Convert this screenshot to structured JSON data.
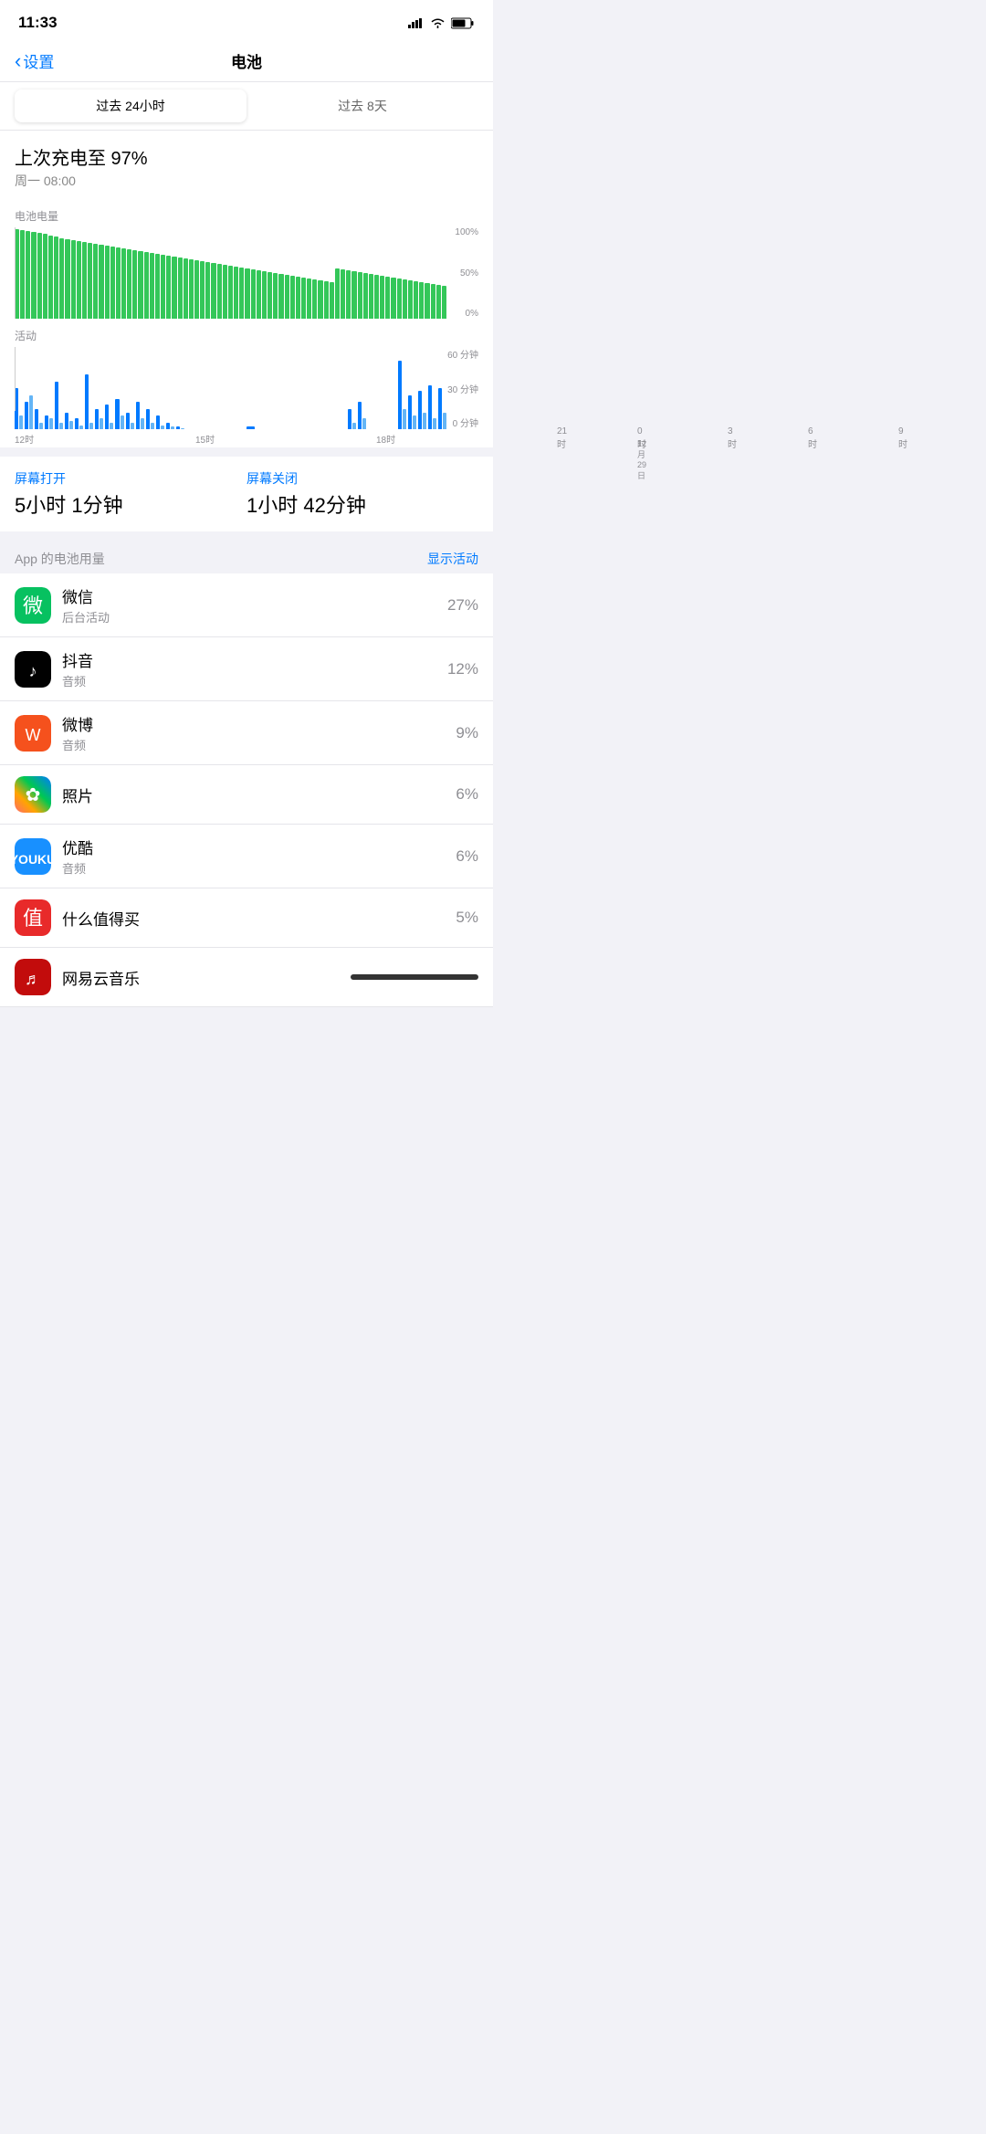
{
  "statusBar": {
    "time": "11:33"
  },
  "navBar": {
    "backLabel": "设置",
    "title": "电池"
  },
  "tabs": [
    {
      "label": "过去 24小时",
      "active": true
    },
    {
      "label": "过去 8天",
      "active": false
    }
  ],
  "lastCharge": {
    "title": "上次充电至 97%",
    "time": "周一 08:00"
  },
  "batteryChart": {
    "label": "电池电量",
    "yLabels": [
      "100%",
      "50%",
      "0%"
    ],
    "bars": [
      98,
      97,
      96,
      95,
      94,
      93,
      91,
      90,
      88,
      87,
      86,
      85,
      84,
      83,
      82,
      81,
      80,
      79,
      78,
      77,
      76,
      75,
      74,
      73,
      72,
      71,
      70,
      69,
      68,
      67,
      66,
      65,
      64,
      63,
      62,
      61,
      60,
      59,
      58,
      57,
      56,
      55,
      54,
      53,
      52,
      51,
      50,
      49,
      48,
      47,
      46,
      45,
      44,
      43,
      42,
      41,
      40,
      55,
      54,
      53,
      52,
      51,
      50,
      49,
      48,
      47,
      46,
      45,
      44,
      43,
      42,
      41,
      40,
      39,
      38,
      37,
      36
    ]
  },
  "activityChart": {
    "label": "活动",
    "yLabels": [
      "60 分钟",
      "30 分钟",
      "0 分钟"
    ],
    "xLabels": [
      {
        "label": "12时",
        "pos": 0
      },
      {
        "label": "15时",
        "pos": 18
      },
      {
        "label": "18时",
        "pos": 36
      },
      {
        "label": "21时",
        "pos": 54
      },
      {
        "label": "0时",
        "pos": 62,
        "date": "12月29日"
      },
      {
        "label": "3时",
        "pos": 71
      },
      {
        "label": "6时",
        "pos": 79
      },
      {
        "label": "9时",
        "pos": 88
      }
    ],
    "bars": [
      {
        "dark": 30,
        "light": 10
      },
      {
        "dark": 20,
        "light": 25
      },
      {
        "dark": 15,
        "light": 5
      },
      {
        "dark": 10,
        "light": 8
      },
      {
        "dark": 35,
        "light": 5
      },
      {
        "dark": 12,
        "light": 6
      },
      {
        "dark": 8,
        "light": 3
      },
      {
        "dark": 40,
        "light": 5
      },
      {
        "dark": 15,
        "light": 8
      },
      {
        "dark": 18,
        "light": 5
      },
      {
        "dark": 22,
        "light": 10
      },
      {
        "dark": 12,
        "light": 5
      },
      {
        "dark": 20,
        "light": 8
      },
      {
        "dark": 15,
        "light": 5
      },
      {
        "dark": 10,
        "light": 3
      },
      {
        "dark": 5,
        "light": 2
      },
      {
        "dark": 2,
        "light": 1
      },
      {
        "dark": 0,
        "light": 0
      },
      {
        "dark": 0,
        "light": 0
      },
      {
        "dark": 0,
        "light": 0
      },
      {
        "dark": 0,
        "light": 0
      },
      {
        "dark": 0,
        "light": 0
      },
      {
        "dark": 0,
        "light": 0
      },
      {
        "dark": 2,
        "light": 0
      },
      {
        "dark": 0,
        "light": 0
      },
      {
        "dark": 0,
        "light": 0
      },
      {
        "dark": 0,
        "light": 0
      },
      {
        "dark": 0,
        "light": 0
      },
      {
        "dark": 0,
        "light": 0
      },
      {
        "dark": 0,
        "light": 0
      },
      {
        "dark": 0,
        "light": 0
      },
      {
        "dark": 0,
        "light": 0
      },
      {
        "dark": 0,
        "light": 0
      },
      {
        "dark": 15,
        "light": 5
      },
      {
        "dark": 20,
        "light": 8
      },
      {
        "dark": 0,
        "light": 0
      },
      {
        "dark": 0,
        "light": 0
      },
      {
        "dark": 0,
        "light": 0
      },
      {
        "dark": 50,
        "light": 15
      },
      {
        "dark": 25,
        "light": 10
      },
      {
        "dark": 28,
        "light": 12
      },
      {
        "dark": 32,
        "light": 8
      },
      {
        "dark": 30,
        "light": 12
      }
    ]
  },
  "screenOn": {
    "label": "屏幕打开",
    "value": "5小时 1分钟"
  },
  "screenOff": {
    "label": "屏幕关闭",
    "value": "1小时 42分钟"
  },
  "appBattery": {
    "title": "App 的电池用量",
    "showActivity": "显示活动",
    "apps": [
      {
        "name": "微信",
        "sub": "后台活动",
        "percent": "27%",
        "iconType": "wechat"
      },
      {
        "name": "抖音",
        "sub": "音频",
        "percent": "12%",
        "iconType": "douyin"
      },
      {
        "name": "微博",
        "sub": "音频",
        "percent": "9%",
        "iconType": "weibo"
      },
      {
        "name": "照片",
        "sub": "",
        "percent": "6%",
        "iconType": "photos"
      },
      {
        "name": "优酷",
        "sub": "音频",
        "percent": "6%",
        "iconType": "youku"
      },
      {
        "name": "什么值得买",
        "sub": "",
        "percent": "5%",
        "iconType": "smzdm"
      },
      {
        "name": "网易云音乐",
        "sub": "",
        "percent": "",
        "iconType": "netease"
      }
    ]
  }
}
